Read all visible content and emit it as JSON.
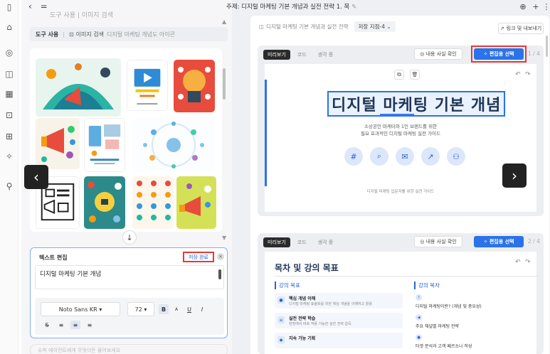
{
  "rail": {
    "icons": [
      "sidebar-toggle-icon",
      "home-icon",
      "search-icon",
      "projects-icon",
      "grid-icon",
      "add-image-icon",
      "add-document-icon",
      "sparkle-icon",
      "profile-icon"
    ]
  },
  "left_panel": {
    "back_glyph": "‹",
    "menu_glyph": "=",
    "truncated_title": "도구 사용 | 이미지 검색",
    "toolbar": {
      "label": "도구 사용",
      "separator": "|",
      "action": "이미지 검색",
      "query": "디지털 마케팅 개념도 아이콘"
    },
    "down_glyph": "↓",
    "prev_glyph": "‹",
    "editor": {
      "heading": "텍스트 편집",
      "save_label": "저장 완료",
      "close_glyph": "×",
      "text": "디지털 마케팅 기본 개념",
      "font_family": "Noto Sans KR ▾",
      "font_size": "72 ▾",
      "bold": "B",
      "superscript": "A",
      "underline": "U",
      "italic": "I",
      "strike": "S",
      "align_left": "≡",
      "align_center": "≡",
      "align_right": "≡"
    },
    "chat_placeholder": "슈퍼 에이전트에게 무엇이든 물어보세요"
  },
  "main": {
    "title": "주제: 디지털 마케팅 기본 개념과 실전 전략 1. 목",
    "edit_glyph": "✎",
    "globe_glyph": "⊕",
    "plus_glyph": "+",
    "more_glyph": "⋮",
    "doc_bar": {
      "label": "디지털 마케팅 기본 개념과 실전 전략",
      "version": "저장 지점-4 ⌄",
      "share": "링크 및 내보내기"
    },
    "slide1": {
      "tabs": [
        "미리보기",
        "코드",
        "생각 중"
      ],
      "fact_check": "◎ 내용 사실 확인",
      "select_edit": "✧ 편집용 선택",
      "pager": "1 / 4",
      "title": "디지털 마케팅 기본 개념",
      "subtitle_1": "소상공인 마케터와 1인 브랜드를 위한",
      "subtitle_2": "필요 효과적인 디지털 마케팅 실전 가이드",
      "footer": "디지털 마케팅 입문자를 위한 실전 가이드",
      "icons": [
        "#",
        "⌕",
        "✉",
        "↗",
        "⚇"
      ],
      "next_glyph": "›",
      "copy_glyph": "⧉",
      "delete_glyph": "🗑",
      "undo": "↶",
      "redo": "↷"
    },
    "slide2": {
      "tabs": [
        "미리보기",
        "코드",
        "생각 중"
      ],
      "fact_check": "◎ 내용 사실 확인",
      "select_edit": "✧ 편집용 선택",
      "pager": "2 / 4",
      "title": "목차 및 강의 목표",
      "undo": "↶",
      "redo": "↷",
      "col_left": "강의 목표",
      "col_right": "강의 목차",
      "items": [
        {
          "title": "핵심 개념 이해",
          "desc": "디지털 마케팅 효율화를 위한 핵심 개념을 이해하고 활용"
        },
        {
          "title": "실전 전략 학습",
          "desc": "현장에서 바로 적용 가능한 실전 전략 습득"
        },
        {
          "title": "지속 가능 기획",
          "desc": ""
        }
      ],
      "goals": [
        "디지털 마케팅이란? (개념 및 중요성)",
        "주요 채널별 마케팅 전략",
        "타겟 분석과 고객 페르소나 작성"
      ],
      "goal_icons": [
        "?",
        "◀",
        "●"
      ]
    }
  },
  "colors": {
    "accent": "#2a73e8",
    "highlight": "#e53935",
    "title_navy": "#1f3556"
  }
}
